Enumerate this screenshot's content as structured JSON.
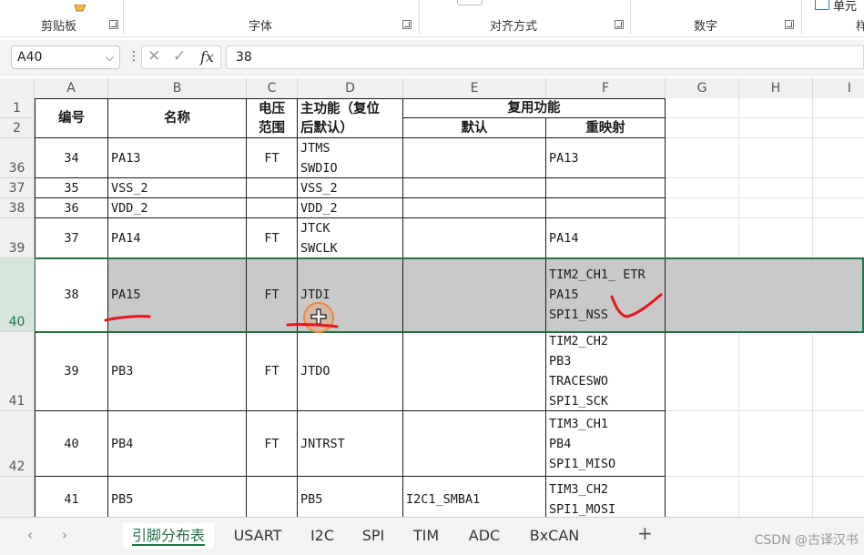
{
  "ribbon": {
    "groups": [
      "剪贴板",
      "字体",
      "对齐方式",
      "数字"
    ],
    "right_label": "单元",
    "edge_char": "样"
  },
  "formula_bar": {
    "name_box": "A40",
    "fx_label": "fx",
    "cancel_symbol": "✕",
    "enter_symbol": "✓",
    "value": "38"
  },
  "columns": [
    "A",
    "B",
    "C",
    "D",
    "E",
    "F",
    "G",
    "H",
    "I"
  ],
  "rows": [
    "1",
    "2",
    "36",
    "37",
    "38",
    "39",
    "40",
    "41",
    "42"
  ],
  "table": {
    "header": {
      "num": "编号",
      "name": "名称",
      "voltage": "电压\n范围",
      "main_func": "主功能（复位\n后默认）",
      "alt_func": "复用功能",
      "default": "默认",
      "remap": "重映射"
    },
    "rows": [
      {
        "num": "34",
        "name": "PA13",
        "ft": "FT",
        "main": "JTMS\nSWDIO",
        "default": "",
        "remap": "PA13"
      },
      {
        "num": "35",
        "name": "VSS_2",
        "ft": "",
        "main": "VSS_2",
        "default": "",
        "remap": ""
      },
      {
        "num": "36",
        "name": "VDD_2",
        "ft": "",
        "main": "VDD_2",
        "default": "",
        "remap": ""
      },
      {
        "num": "37",
        "name": "PA14",
        "ft": "FT",
        "main": "JTCK\nSWCLK",
        "default": "",
        "remap": "PA14"
      },
      {
        "num": "38",
        "name": "PA15",
        "ft": "FT",
        "main": "JTDI",
        "default": "",
        "remap": "TIM2_CH1_ ETR\nPA15\nSPI1_NSS"
      },
      {
        "num": "39",
        "name": "PB3",
        "ft": "FT",
        "main": "JTDO",
        "default": "",
        "remap": "TIM2_CH2\nPB3\nTRACESWO\nSPI1_SCK"
      },
      {
        "num": "40",
        "name": "PB4",
        "ft": "FT",
        "main": "JNTRST",
        "default": "",
        "remap": "TIM3_CH1\nPB4\nSPI1_MISO"
      },
      {
        "num": "41",
        "name": "PB5",
        "ft": "",
        "main": "PB5",
        "default": "I2C1_SMBA1",
        "remap": "TIM3_CH2\nSPI1_MOSI"
      }
    ]
  },
  "sheet_tabs": {
    "tabs": [
      "引脚分布表",
      "USART",
      "I2C",
      "SPI",
      "TIM",
      "ADC",
      "BxCAN"
    ],
    "active": "引脚分布表",
    "prev": "‹",
    "next": "›",
    "add": "+"
  },
  "watermark": "CSDN @古译汉书",
  "colors": {
    "accent": "#217346",
    "selected_row": "#c9c9c9",
    "annotation": "#e8141b"
  }
}
